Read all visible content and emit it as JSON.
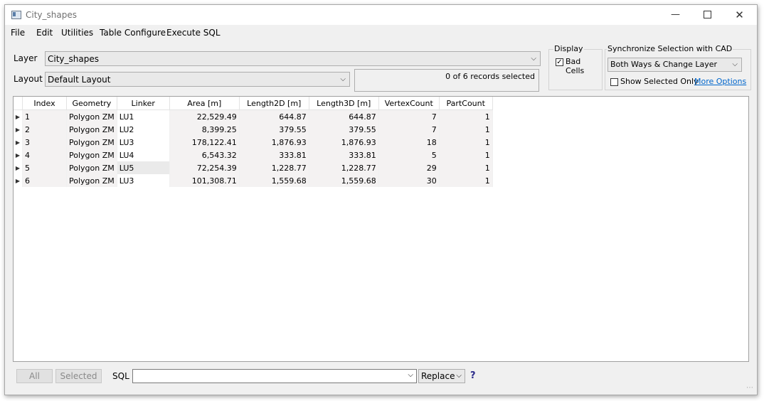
{
  "window": {
    "title": "City_shapes",
    "minimize": "—",
    "close": "✕"
  },
  "menu": [
    "File",
    "Edit",
    "Utilities",
    "Table Configure",
    "Execute SQL"
  ],
  "layer": {
    "label": "Layer",
    "value": "City_shapes"
  },
  "layout": {
    "label": "Layout",
    "value": "Default Layout"
  },
  "status": "0 of 6 records selected",
  "display": {
    "title": "Display",
    "bad_cells_label": "Bad Cells",
    "bad_cells_checked": "✓"
  },
  "sync": {
    "title": "Synchronize Selection with CAD",
    "value": "Both Ways & Change Layer",
    "show_selected_label": "Show Selected Only",
    "more_options": "More Options"
  },
  "table": {
    "columns": [
      "Index",
      "Geometry",
      "Linker",
      "Area [m]",
      "Length2D [m]",
      "Length3D [m]",
      "VertexCount",
      "PartCount"
    ],
    "rows": [
      [
        "1",
        "Polygon ZM",
        "LU1",
        "22,529.49",
        "644.87",
        "644.87",
        "7",
        "1"
      ],
      [
        "2",
        "Polygon ZM",
        "LU2",
        "8,399.25",
        "379.55",
        "379.55",
        "7",
        "1"
      ],
      [
        "3",
        "Polygon ZM",
        "LU3",
        "178,122.41",
        "1,876.93",
        "1,876.93",
        "18",
        "1"
      ],
      [
        "4",
        "Polygon ZM",
        "LU4",
        "6,543.32",
        "333.81",
        "333.81",
        "5",
        "1"
      ],
      [
        "5",
        "Polygon ZM",
        "LU5",
        "72,254.39",
        "1,228.77",
        "1,228.77",
        "29",
        "1"
      ],
      [
        "6",
        "Polygon ZM",
        "LU3",
        "101,308.71",
        "1,559.68",
        "1,559.68",
        "30",
        "1"
      ]
    ]
  },
  "bottom": {
    "all": "All",
    "selected": "Selected",
    "sql_label": "SQL",
    "sql_value": "",
    "replace": "Replace",
    "help": "?"
  },
  "colors": {
    "accent": "#0066cc",
    "row_alt": "#f4f2f2"
  }
}
